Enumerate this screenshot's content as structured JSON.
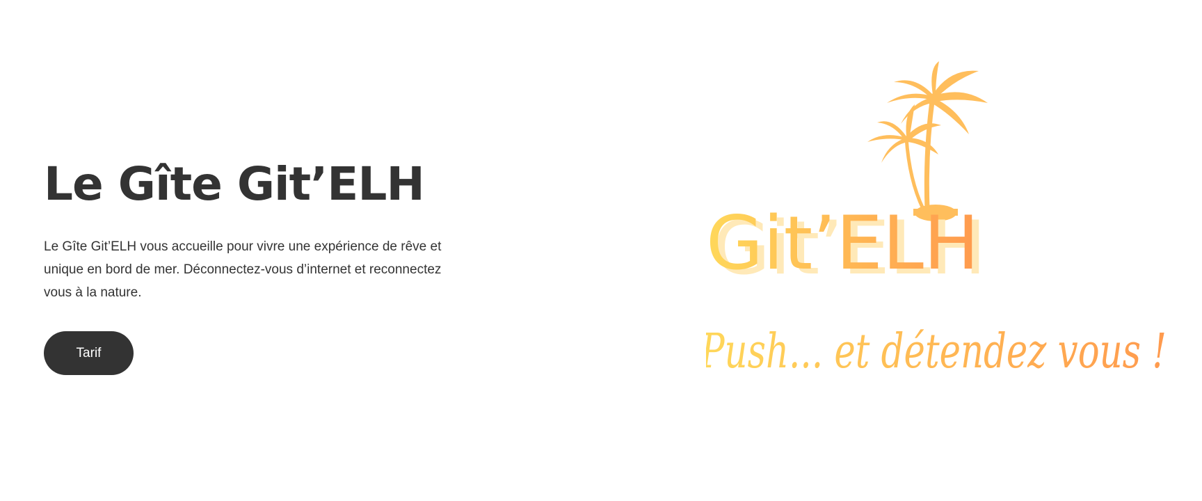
{
  "hero": {
    "title": "Le Gîte Git’ELH",
    "description": "Le Gîte Git’ELH vous accueille pour vivre une expérience de rêve et unique en bord de mer. Déconnectez-vous d’internet et reconnectez vous à la nature.",
    "button_label": "Tarif"
  },
  "logo": {
    "name": "Git’ELH",
    "tagline": "Push... et détendez vous !",
    "icon": "palm-trees-icon",
    "colors": {
      "palm": "#FFBE5C",
      "gradient_start": "#FFD85A",
      "gradient_end": "#FF9A4E",
      "shadow": "#FFE9B8"
    }
  },
  "theme": {
    "text_color": "#333333",
    "button_bg": "#333333",
    "button_text": "#FFFFFF",
    "background": "#FFFFFF"
  }
}
